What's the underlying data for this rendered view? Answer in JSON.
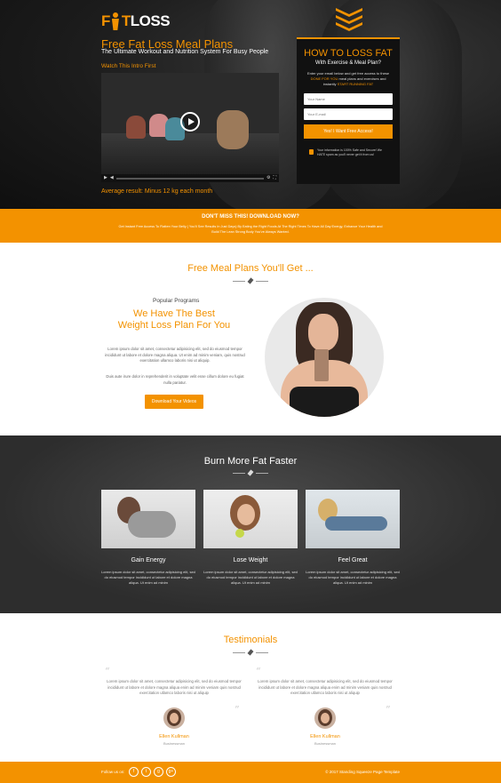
{
  "brand": {
    "logo_a": "F",
    "logo_mid": "T",
    "logo_b": "LOSS"
  },
  "hero": {
    "title": "Free Fat Loss Meal Plans",
    "subtitle": "The Ultimate Workout and Nutrition System For Busy People",
    "intro_link": "Watch This Intro First",
    "avg_result": "Average result: Minus 12 kg each month"
  },
  "form": {
    "heading": "HOW TO LOSS FAT",
    "subheading": "With Exercise & Meal Plan?",
    "desc_1": "Enter your email below and get free access to these",
    "desc_hl1": "DONE FOR YOU",
    "desc_2": "meal plans and exercises and instantly",
    "desc_hl2": "START RUNNING FAT",
    "name_placeholder": "Your Name",
    "email_placeholder": "Your E-mail",
    "submit": "Yes! I Want Free Access!",
    "secure": "Your information is 100% Safe and Secure! We HATE spam as you'll never get it from us!"
  },
  "banner": {
    "title": "DON'T MISS THIS! DOWNLOAD NOW?",
    "desc": "Get Instant Free Access To Flatten Your Belly ( You'll See Results In Just Days) By Eating the Right Foods At The Right Times To Have All Day Energy, Enhance Your Health and Build The Lean Strong Body You've Always Wanted."
  },
  "meals": {
    "title": "Free Meal Plans You'll Get ...",
    "kicker": "Popular Programs",
    "heading_1": "We Have The Best",
    "heading_2": "Weight Loss Plan For You",
    "p1": "Lorem ipsum dolor sit amet, consectetur adipisicing elit, sed do eiusmod tempor incididunt ut labore et dolore magna aliqua. Ut enim ad minim veniam, quis nostrud exercitation ullamco laboris nisi ut aliquip.",
    "p2": "Duis aute irure dolor in reprehenderit in voluptate velit esse cillum dolore eu fugiat nulla pariatur.",
    "button": "Download Your Videos"
  },
  "burn": {
    "title": "Burn More Fat Faster",
    "cards": [
      {
        "title": "Gain Energy",
        "text": "Lorem ipsum dolor sit amet, consectetur adipisicing elit, sed do eiusmod tempor incididunt ut labore et dolore magna aliqua. Ut enim ad minim"
      },
      {
        "title": "Lose Weight",
        "text": "Lorem ipsum dolor sit amet, consectetur adipisicing elit, sed do eiusmod tempor incididunt ut labore et dolore magna aliqua. Ut enim ad minim"
      },
      {
        "title": "Feel Great",
        "text": "Lorem ipsum dolor sit amet, consectetur adipisicing elit, sed do eiusmod tempor incididunt ut labore et dolore magna aliqua. Ut enim ad minim"
      }
    ]
  },
  "testimonials": {
    "title": "Testimonials",
    "items": [
      {
        "quote": "Lorem ipsum dolor sit amet, consectetur adipisicing elit, sed do eiusmod tempor incididunt ut labore et dolore magna aliqua enim ad minim veniam quis nostrud exercitation ullamco laboris nisi ut aliquip",
        "name": "Ellen  Kullman",
        "role": "Businessman"
      },
      {
        "quote": "Lorem ipsum dolor sit amet, consectetur adipisicing elit, sed do eiusmod tempor incididunt ut labore et dolore magna aliqua enim ad minim veniam quis nostrud exercitation ullamco laboris nisi ut aliquip",
        "name": "Ellen  Kullman",
        "role": "Businessman"
      }
    ]
  },
  "footer": {
    "follow": "Follow us on:",
    "social": [
      "f",
      "t",
      "g",
      "g+"
    ],
    "copyright": "© 2017 Standing Squeeze Page Template"
  },
  "colors": {
    "accent": "#f39200",
    "dark": "#111111"
  }
}
